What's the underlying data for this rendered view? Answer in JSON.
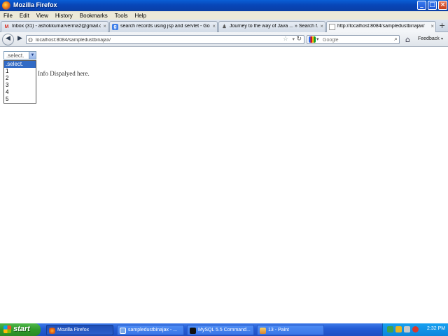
{
  "window": {
    "title": "Mozilla Firefox",
    "buttons": {
      "minimize": "_",
      "maximize": "□",
      "close": "×"
    }
  },
  "menu": [
    "File",
    "Edit",
    "View",
    "History",
    "Bookmarks",
    "Tools",
    "Help"
  ],
  "tabs": [
    {
      "label": "Inbox (31) - ashokkumarverma2@gmail.c...",
      "icon": "gmail-icon"
    },
    {
      "label": "search records using jsp and servlet - Go...",
      "icon": "google-icon"
    },
    {
      "label": "Journey to the way of Java ... » Search f...",
      "icon": "page-icon"
    },
    {
      "label": "http://localhost:8084/sampledustbinajax/",
      "icon": "page-icon",
      "active": true
    }
  ],
  "nav": {
    "url": "localhost:8084/sampledustbinajax/",
    "search_placeholder": "Google",
    "feedback": "Feedback"
  },
  "page": {
    "select": {
      "value": ".select.",
      "options": [
        ".select.",
        "1",
        "2",
        "3",
        "4",
        "5"
      ],
      "selected_index": 0
    },
    "info_text": "Info Dispalyed here."
  },
  "taskbar": {
    "start": "start",
    "tasks": [
      {
        "label": "Mozilla Firefox",
        "active": true
      },
      {
        "label": "sampledustbinajax - ..."
      },
      {
        "label": "MySQL 5.5 Command..."
      },
      {
        "label": "13 - Paint"
      }
    ],
    "clock": "2:32 PM"
  },
  "colors": {
    "titlebar": "#0a5fd6",
    "taskbar": "#245dd6",
    "start": "#2f9a2a",
    "selection": "#316ac5"
  }
}
